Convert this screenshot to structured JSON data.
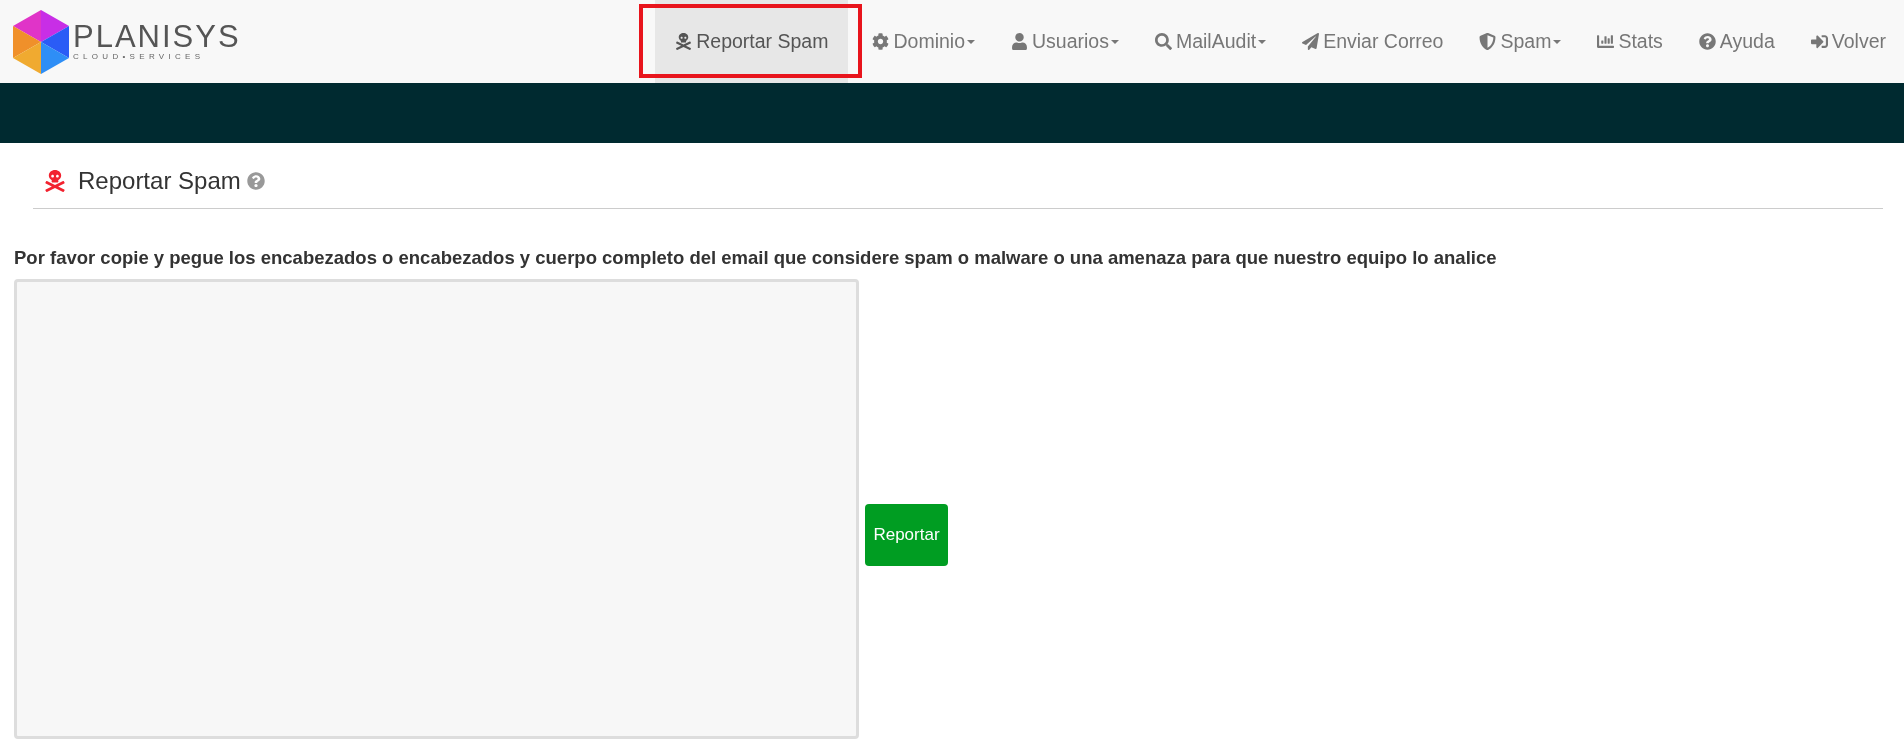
{
  "brand": {
    "name": "PLANISYS",
    "tagline": "CLOUD•SERVICES"
  },
  "nav": [
    {
      "label": "Reportar Spam",
      "selected": true,
      "has_menu": false,
      "highlighted": true
    },
    {
      "label": "Dominio",
      "selected": false,
      "has_menu": true,
      "highlighted": false
    },
    {
      "label": "Usuarios",
      "selected": false,
      "has_menu": true,
      "highlighted": false
    },
    {
      "label": "MailAudit",
      "selected": false,
      "has_menu": true,
      "highlighted": false
    },
    {
      "label": "Enviar Correo",
      "selected": false,
      "has_menu": false,
      "highlighted": false
    },
    {
      "label": "Spam",
      "selected": false,
      "has_menu": true,
      "highlighted": false
    },
    {
      "label": "Stats",
      "selected": false,
      "has_menu": false,
      "highlighted": false
    },
    {
      "label": "Ayuda",
      "selected": false,
      "has_menu": false,
      "highlighted": false
    },
    {
      "label": "Volver",
      "selected": false,
      "has_menu": false,
      "highlighted": false
    }
  ],
  "page": {
    "title": "Reportar Spam",
    "instructions": "Por favor copie y pegue los encabezados o encabezados y cuerpo completo del email que considere spam o malware o una amenaza para que nuestro equipo lo analice",
    "submit": "Reportar"
  }
}
